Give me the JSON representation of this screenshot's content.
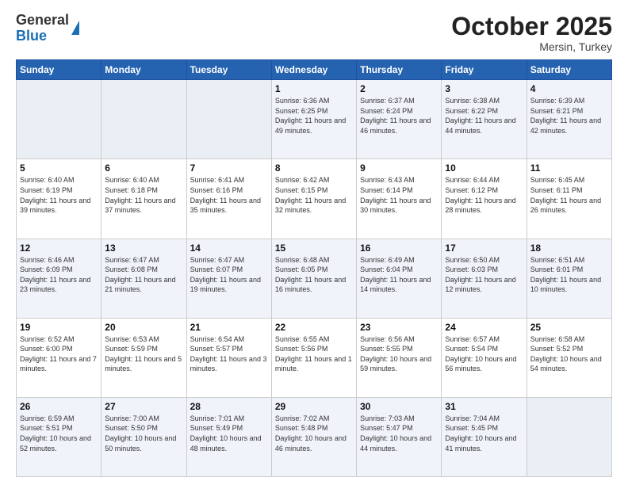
{
  "logo": {
    "general": "General",
    "blue": "Blue"
  },
  "header": {
    "month": "October 2025",
    "location": "Mersin, Turkey"
  },
  "weekdays": [
    "Sunday",
    "Monday",
    "Tuesday",
    "Wednesday",
    "Thursday",
    "Friday",
    "Saturday"
  ],
  "weeks": [
    [
      {
        "day": "",
        "info": ""
      },
      {
        "day": "",
        "info": ""
      },
      {
        "day": "",
        "info": ""
      },
      {
        "day": "1",
        "info": "Sunrise: 6:36 AM\nSunset: 6:25 PM\nDaylight: 11 hours and 49 minutes."
      },
      {
        "day": "2",
        "info": "Sunrise: 6:37 AM\nSunset: 6:24 PM\nDaylight: 11 hours and 46 minutes."
      },
      {
        "day": "3",
        "info": "Sunrise: 6:38 AM\nSunset: 6:22 PM\nDaylight: 11 hours and 44 minutes."
      },
      {
        "day": "4",
        "info": "Sunrise: 6:39 AM\nSunset: 6:21 PM\nDaylight: 11 hours and 42 minutes."
      }
    ],
    [
      {
        "day": "5",
        "info": "Sunrise: 6:40 AM\nSunset: 6:19 PM\nDaylight: 11 hours and 39 minutes."
      },
      {
        "day": "6",
        "info": "Sunrise: 6:40 AM\nSunset: 6:18 PM\nDaylight: 11 hours and 37 minutes."
      },
      {
        "day": "7",
        "info": "Sunrise: 6:41 AM\nSunset: 6:16 PM\nDaylight: 11 hours and 35 minutes."
      },
      {
        "day": "8",
        "info": "Sunrise: 6:42 AM\nSunset: 6:15 PM\nDaylight: 11 hours and 32 minutes."
      },
      {
        "day": "9",
        "info": "Sunrise: 6:43 AM\nSunset: 6:14 PM\nDaylight: 11 hours and 30 minutes."
      },
      {
        "day": "10",
        "info": "Sunrise: 6:44 AM\nSunset: 6:12 PM\nDaylight: 11 hours and 28 minutes."
      },
      {
        "day": "11",
        "info": "Sunrise: 6:45 AM\nSunset: 6:11 PM\nDaylight: 11 hours and 26 minutes."
      }
    ],
    [
      {
        "day": "12",
        "info": "Sunrise: 6:46 AM\nSunset: 6:09 PM\nDaylight: 11 hours and 23 minutes."
      },
      {
        "day": "13",
        "info": "Sunrise: 6:47 AM\nSunset: 6:08 PM\nDaylight: 11 hours and 21 minutes."
      },
      {
        "day": "14",
        "info": "Sunrise: 6:47 AM\nSunset: 6:07 PM\nDaylight: 11 hours and 19 minutes."
      },
      {
        "day": "15",
        "info": "Sunrise: 6:48 AM\nSunset: 6:05 PM\nDaylight: 11 hours and 16 minutes."
      },
      {
        "day": "16",
        "info": "Sunrise: 6:49 AM\nSunset: 6:04 PM\nDaylight: 11 hours and 14 minutes."
      },
      {
        "day": "17",
        "info": "Sunrise: 6:50 AM\nSunset: 6:03 PM\nDaylight: 11 hours and 12 minutes."
      },
      {
        "day": "18",
        "info": "Sunrise: 6:51 AM\nSunset: 6:01 PM\nDaylight: 11 hours and 10 minutes."
      }
    ],
    [
      {
        "day": "19",
        "info": "Sunrise: 6:52 AM\nSunset: 6:00 PM\nDaylight: 11 hours and 7 minutes."
      },
      {
        "day": "20",
        "info": "Sunrise: 6:53 AM\nSunset: 5:59 PM\nDaylight: 11 hours and 5 minutes."
      },
      {
        "day": "21",
        "info": "Sunrise: 6:54 AM\nSunset: 5:57 PM\nDaylight: 11 hours and 3 minutes."
      },
      {
        "day": "22",
        "info": "Sunrise: 6:55 AM\nSunset: 5:56 PM\nDaylight: 11 hours and 1 minute."
      },
      {
        "day": "23",
        "info": "Sunrise: 6:56 AM\nSunset: 5:55 PM\nDaylight: 10 hours and 59 minutes."
      },
      {
        "day": "24",
        "info": "Sunrise: 6:57 AM\nSunset: 5:54 PM\nDaylight: 10 hours and 56 minutes."
      },
      {
        "day": "25",
        "info": "Sunrise: 6:58 AM\nSunset: 5:52 PM\nDaylight: 10 hours and 54 minutes."
      }
    ],
    [
      {
        "day": "26",
        "info": "Sunrise: 6:59 AM\nSunset: 5:51 PM\nDaylight: 10 hours and 52 minutes."
      },
      {
        "day": "27",
        "info": "Sunrise: 7:00 AM\nSunset: 5:50 PM\nDaylight: 10 hours and 50 minutes."
      },
      {
        "day": "28",
        "info": "Sunrise: 7:01 AM\nSunset: 5:49 PM\nDaylight: 10 hours and 48 minutes."
      },
      {
        "day": "29",
        "info": "Sunrise: 7:02 AM\nSunset: 5:48 PM\nDaylight: 10 hours and 46 minutes."
      },
      {
        "day": "30",
        "info": "Sunrise: 7:03 AM\nSunset: 5:47 PM\nDaylight: 10 hours and 44 minutes."
      },
      {
        "day": "31",
        "info": "Sunrise: 7:04 AM\nSunset: 5:45 PM\nDaylight: 10 hours and 41 minutes."
      },
      {
        "day": "",
        "info": ""
      }
    ]
  ]
}
